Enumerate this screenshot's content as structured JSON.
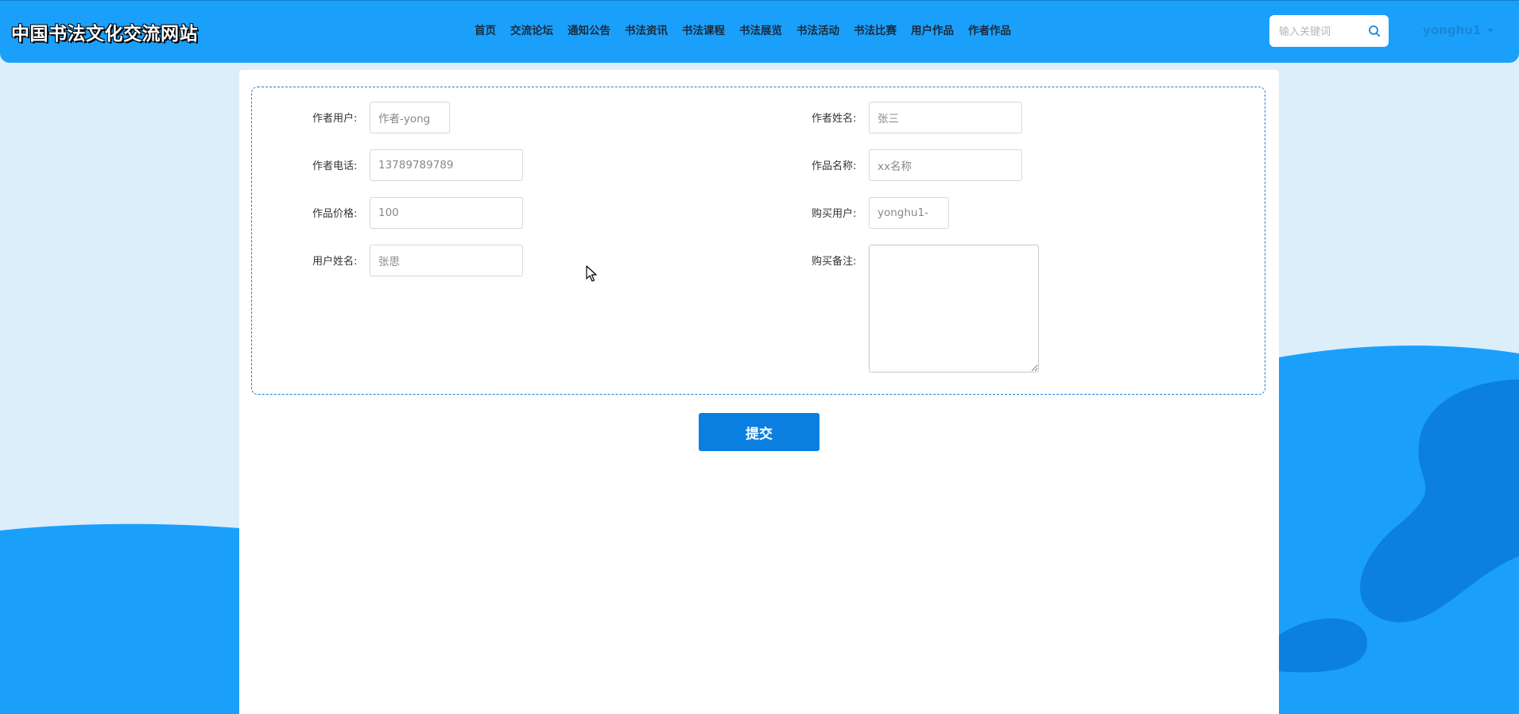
{
  "site": {
    "title": "中国书法文化交流网站"
  },
  "nav": {
    "items": [
      "首页",
      "交流论坛",
      "通知公告",
      "书法资讯",
      "书法课程",
      "书法展览",
      "书法活动",
      "书法比赛",
      "用户作品",
      "作者作品"
    ]
  },
  "search": {
    "placeholder": "输入关键词"
  },
  "user": {
    "name": "yonghu1"
  },
  "form": {
    "fields": [
      {
        "label": "作者用户:",
        "value": "作者-yong"
      },
      {
        "label": "作者姓名:",
        "value": "张三"
      },
      {
        "label": "作者电话:",
        "value": "13789789789"
      },
      {
        "label": "作品名称:",
        "value": "xx名称"
      },
      {
        "label": "作品价格:",
        "value": "100"
      },
      {
        "label": "购买用户:",
        "value": "yonghu1-"
      },
      {
        "label": "用户姓名:",
        "value": "张思"
      },
      {
        "label": "购买备注:",
        "value": ""
      }
    ],
    "submit_label": "提交"
  },
  "colors": {
    "primary": "#1aa0fb",
    "button": "#0b7fe0",
    "background": "#dbeefa"
  }
}
